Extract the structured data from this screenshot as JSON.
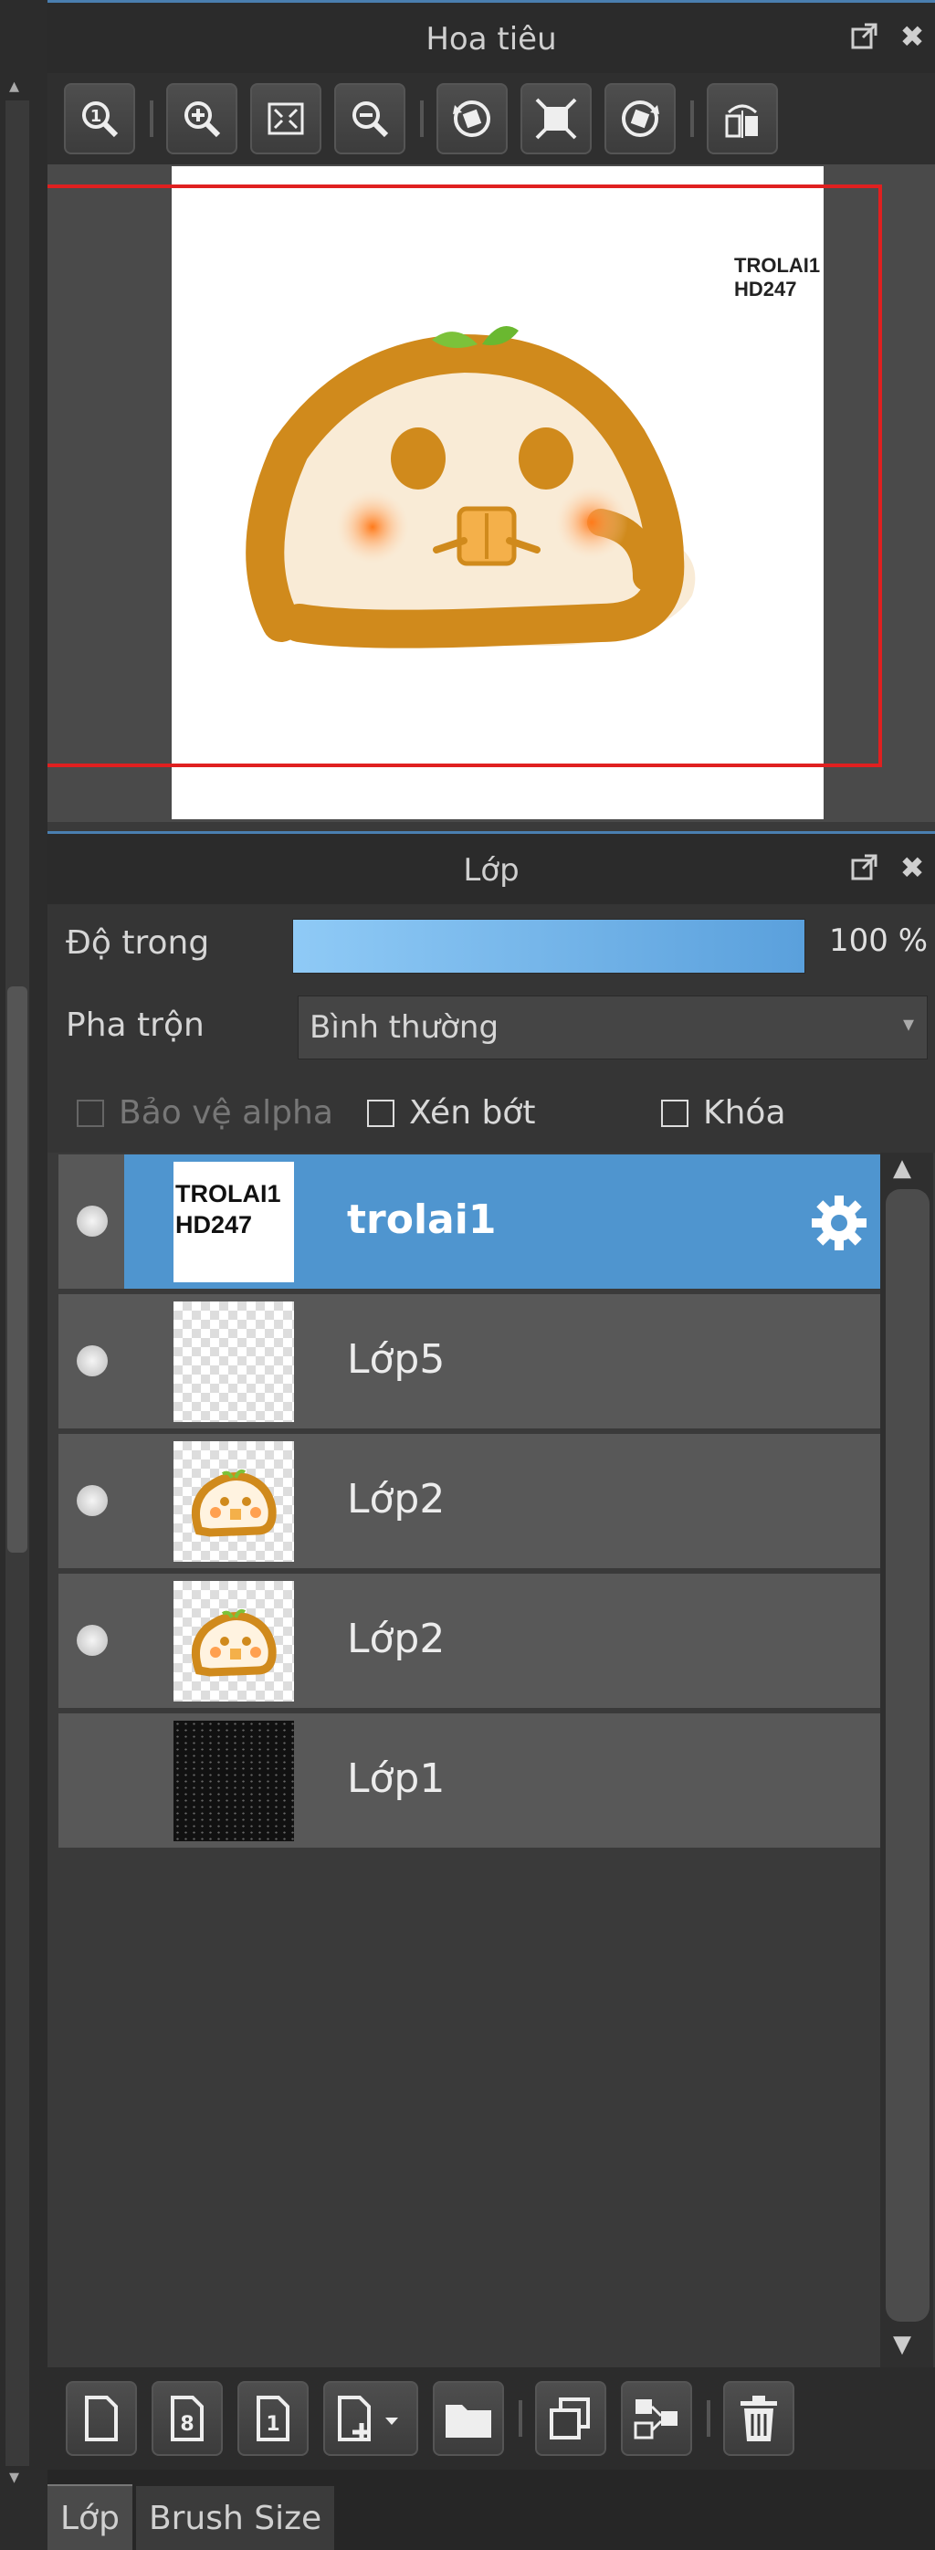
{
  "navigator": {
    "title": "Hoa tiêu",
    "canvas_watermark": [
      "TROLAI1",
      "HD247"
    ],
    "toolbar": [
      "zoom-reset",
      "zoom-in",
      "fit",
      "zoom-out",
      "rotate-left",
      "actual-size",
      "rotate-right",
      "flip-horizontal"
    ]
  },
  "layers_panel": {
    "title": "Lớp",
    "opacity_label": "Độ trong",
    "opacity_value": "100 %",
    "opacity_level": 1.0,
    "blend_label": "Pha trộn",
    "blend_value": "Bình thường",
    "protect_alpha_label": "Bảo vệ alpha",
    "clipping_label": "Xén bớt",
    "lock_label": "Khóa",
    "layers": [
      {
        "name": "trolai1",
        "selected": true,
        "visible": true,
        "thumb_text": [
          "TROLAI1",
          "HD247"
        ]
      },
      {
        "name": "Lớp5",
        "selected": false,
        "visible": true
      },
      {
        "name": "Lớp2",
        "selected": false,
        "visible": true
      },
      {
        "name": "Lớp2",
        "selected": false,
        "visible": true
      },
      {
        "name": "Lớp1",
        "selected": false,
        "visible": false
      }
    ]
  },
  "bottom_toolbar": [
    "new-layer",
    "new-8bit-layer",
    "new-1bit-layer",
    "add-layer-menu",
    "new-folder",
    "duplicate-layer",
    "merge-layer",
    "delete-layer"
  ],
  "tabs": [
    {
      "label": "Lớp",
      "active": true
    },
    {
      "label": "Brush Size",
      "active": false
    }
  ],
  "colors": {
    "accent": "#4f95cf",
    "panel_bg": "#3a3a3a",
    "view_rect": "#e02020"
  }
}
